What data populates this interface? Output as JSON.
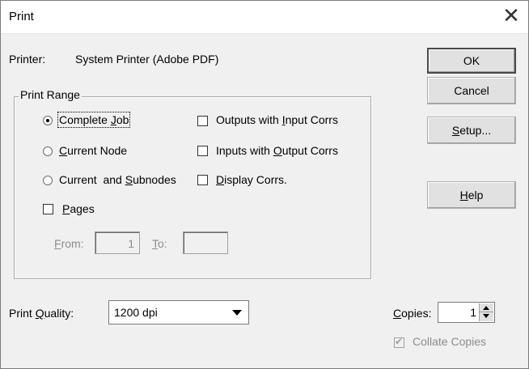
{
  "window": {
    "title": "Print"
  },
  "printer": {
    "label": "Printer:",
    "value": "System Printer (Adobe PDF)"
  },
  "buttons": {
    "ok": "OK",
    "cancel": "Cancel",
    "setup": {
      "pre": "",
      "u": "S",
      "post": "etup..."
    },
    "help": {
      "pre": "",
      "u": "H",
      "post": "elp"
    }
  },
  "print_range": {
    "title": "Print Range",
    "options": {
      "complete_job": {
        "pre": "Complete ",
        "u": "J",
        "post": "ob",
        "selected": true
      },
      "current_node": {
        "pre": "",
        "u": "C",
        "post": "urrent Node",
        "selected": false
      },
      "current_subnodes": {
        "pre": "Current  and ",
        "u": "S",
        "post": "ubnodes",
        "selected": false
      }
    },
    "checks": {
      "outputs_with_input": {
        "pre": "Outputs with ",
        "u": "I",
        "post": "nput Corrs",
        "checked": false
      },
      "inputs_with_output": {
        "pre": "Inputs with ",
        "u": "O",
        "post": "utput Corrs",
        "checked": false
      },
      "display_corrs": {
        "pre": "",
        "u": "D",
        "post": "isplay Corrs.",
        "checked": false
      },
      "pages": {
        "pre": "",
        "u": "P",
        "post": "ages",
        "checked": false
      }
    },
    "from": {
      "pre": "",
      "u": "F",
      "post": "rom:",
      "value": "1"
    },
    "to": {
      "pre": "",
      "u": "T",
      "post": "o:",
      "value": ""
    }
  },
  "quality": {
    "label_pre": "Print ",
    "label_u": "Q",
    "label_post": "uality:",
    "value": "1200 dpi"
  },
  "copies": {
    "label_pre": "",
    "label_u": "C",
    "label_post": "opies:",
    "value": "1"
  },
  "collate": {
    "label": "Collate Copies",
    "checked": true
  }
}
